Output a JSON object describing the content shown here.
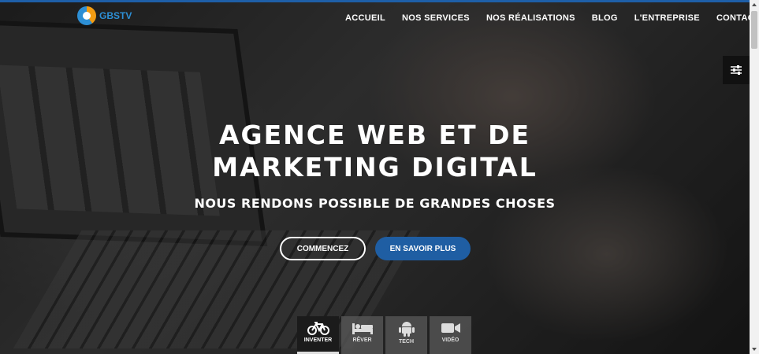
{
  "brand": {
    "logo_text": "GBSTV",
    "accent": "#1e5fa8",
    "logo_orange": "#f39c12"
  },
  "nav": {
    "items": [
      {
        "label": "ACCUEIL"
      },
      {
        "label": "NOS SERVICES"
      },
      {
        "label": "NOS RÉALISATIONS"
      },
      {
        "label": "BLOG"
      },
      {
        "label": "L'ENTREPRISE"
      },
      {
        "label": "CONTACT"
      }
    ]
  },
  "settings": {
    "icon": "sliders-icon"
  },
  "hero": {
    "title_line1": "AGENCE WEB ET DE",
    "title_line2": "MARKETING DIGITAL",
    "subtitle": "NOUS RENDONS POSSIBLE DE GRANDES CHOSES",
    "button_primary": "COMMENCEZ",
    "button_secondary": "EN SAVOIR PLUS"
  },
  "tabs": [
    {
      "label": "INVENTER",
      "icon": "bicycle-icon",
      "active": true
    },
    {
      "label": "RÊVER",
      "icon": "bed-icon",
      "active": false
    },
    {
      "label": "TECH",
      "icon": "android-icon",
      "active": false
    },
    {
      "label": "VIDÉO",
      "icon": "video-camera-icon",
      "active": false
    }
  ]
}
